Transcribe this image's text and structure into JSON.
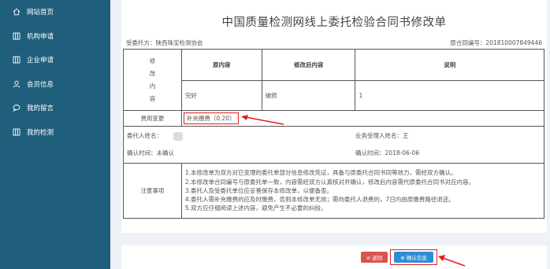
{
  "sidebar": {
    "items": [
      {
        "label": "网站首页",
        "icon": "home-icon"
      },
      {
        "label": "机构申请",
        "icon": "columns-icon"
      },
      {
        "label": "企业申请",
        "icon": "columns-icon"
      },
      {
        "label": "会员信息",
        "icon": "user-icon"
      },
      {
        "label": "我的留言",
        "icon": "chat-icon"
      },
      {
        "label": "我的检测",
        "icon": "columns-icon"
      }
    ]
  },
  "doc": {
    "title": "中国质量检测网线上委托检验合同书修改单",
    "client_label": "受委托方：陕西珠宝检测协会",
    "contract_label": "原合同编号：201810007849446",
    "modify_chars": [
      "修",
      "改",
      "内",
      "容"
    ],
    "headers": {
      "original": "原内容",
      "modified": "修改后内容",
      "note": "说明"
    },
    "row": {
      "original": "完好",
      "modified": "破损",
      "note": "1"
    },
    "fee_label": "费用变更",
    "fee_value": "补充缴费（0.20）",
    "principal_label": "委托人姓名：",
    "handler_label": "业务受理人姓名：王",
    "confirm_time_left": "确认时间：未确认",
    "confirm_time_right": "确认时间：2018-06-06",
    "notes_label": "注意事项",
    "notes": [
      "1.本修改单为双方对已变理的委托单部分信息修改凭证，具备与原委托合同书同等效力，需经双方确认。",
      "2.本修改单合同编号与原委托单一致，内容需经双方认真核对并确认，修改后内容需代原委托合同书对应内容。",
      "3.委托人及受委托单位应妥善保存本修改单，以便备查。",
      "4.委托人需补充缴费的应及时缴费，否则本修改单无效；需向委托人退费的，7日内由原缴费路径退还。",
      "5.双方应仔细阅读上述内容，避免产生不必要的纠纷。"
    ]
  },
  "buttons": {
    "back": "⊘ 返回",
    "confirm": "⊕ 确认信息"
  },
  "colors": {
    "sidebar": "#1f5f7c",
    "annotation_red": "#e41e1e",
    "back": "#d9534f",
    "confirm": "#2d8fd6"
  }
}
